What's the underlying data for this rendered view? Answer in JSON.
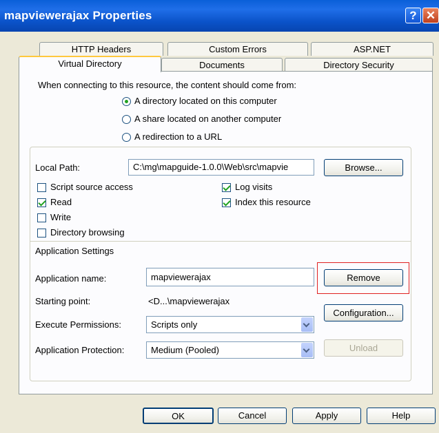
{
  "window": {
    "title": "mapviewerajax Properties",
    "help_glyph": "?",
    "close_glyph": "✕"
  },
  "tabs": {
    "row1": [
      "HTTP Headers",
      "Custom Errors",
      "ASP.NET"
    ],
    "row2": [
      "Virtual Directory",
      "Documents",
      "Directory Security"
    ]
  },
  "source": {
    "intro": "When connecting to this resource, the content should come from:",
    "options": [
      "A directory located on this computer",
      "A share located on another computer",
      "A redirection to a URL"
    ],
    "selected_index": 0
  },
  "local_path": {
    "label": "Local Path:",
    "value": "C:\\mg\\mapguide-1.0.0\\Web\\src\\mapvie",
    "browse_label": "Browse..."
  },
  "checkboxes": {
    "script_source_access": {
      "label": "Script source access",
      "checked": false
    },
    "read": {
      "label": "Read",
      "checked": true
    },
    "write": {
      "label": "Write",
      "checked": false
    },
    "directory_browsing": {
      "label": "Directory browsing",
      "checked": false
    },
    "log_visits": {
      "label": "Log visits",
      "checked": true
    },
    "index_resource": {
      "label": "Index this resource",
      "checked": true
    }
  },
  "app_settings": {
    "heading": "Application Settings",
    "name_label": "Application name:",
    "name_value": "mapviewerajax",
    "remove_label": "Remove",
    "starting_label": "Starting point:",
    "starting_value": "<D...\\mapviewerajax",
    "config_label": "Configuration...",
    "exec_label": "Execute Permissions:",
    "exec_value": "Scripts only",
    "protection_label": "Application Protection:",
    "protection_value": "Medium (Pooled)",
    "unload_label": "Unload"
  },
  "footer": {
    "ok": "OK",
    "cancel": "Cancel",
    "apply": "Apply",
    "help": "Help"
  }
}
